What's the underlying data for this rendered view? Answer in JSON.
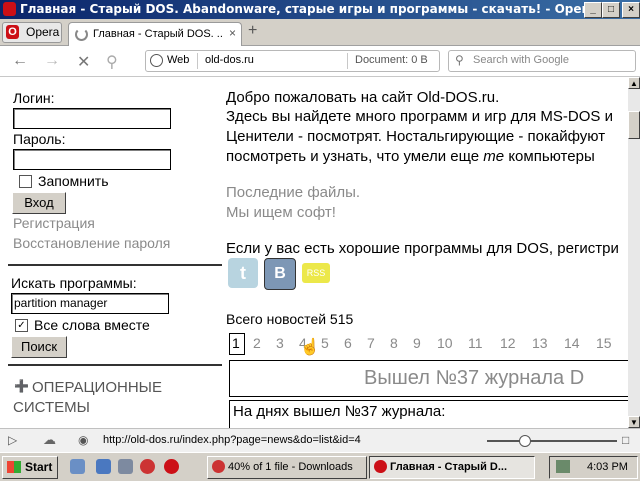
{
  "window": {
    "title": "Главная - Старый DOS. Abandonware, старые игры и программы - скачать! - Opera",
    "controls": {
      "minimize": "_",
      "maximize": "□",
      "close": "×"
    }
  },
  "browser": {
    "menu_button": "Opera",
    "tab_title": "Главная - Старый DOS. ...",
    "tab_close": "×",
    "new_tab": "+",
    "identity": "Web",
    "url": "old-dos.ru",
    "document_size": "Document:   0 B",
    "search_placeholder": "Search with Google"
  },
  "sidebar": {
    "login_label": "Логин:",
    "password_label": "Пароль:",
    "remember_label": "Запомнить",
    "login_button": "Вход",
    "register_link": "Регистрация",
    "restore_link": "Восстановление пароля",
    "search_label": "Искать программы:",
    "search_value": "partition manager",
    "all_words_label": "Все слова вместе",
    "search_button": "Поиск",
    "category_line1": "ОПЕРАЦИОННЫЕ",
    "category_line2": "СИСТЕМЫ"
  },
  "main": {
    "welcome": "Добро пожаловать на сайт Old-DOS.ru.",
    "intro_line1": "Здесь вы найдете много программ и игр для MS-DOS и",
    "intro_line2": "Ценители - посмотрят. Ностальгирующие - покайфуют",
    "intro_line3a": "посмотреть и узнать, что умели еще",
    "intro_line3b": "те",
    "intro_line3c": "компьютеры",
    "recent_files": "Последние файлы.",
    "seeking_software": "Мы ищем софт!",
    "submit_line": "Если у вас есть хорошие программы для DOS, регистри",
    "social": {
      "twitter": "t",
      "vk": "В",
      "rss": "RSS"
    },
    "news_total": "Всего новостей 515",
    "pages": [
      "1",
      "2",
      "3",
      "4",
      "5",
      "6",
      "7",
      "8",
      "9",
      "10",
      "11",
      "12",
      "13",
      "14",
      "15"
    ],
    "news_headline": "Вышел №37 журнала D",
    "news_text": "На днях вышел №37 журнала:"
  },
  "statusbar": {
    "link": "http://old-dos.ru/index.php?page=news&do=list&id=4"
  },
  "taskbar": {
    "start": "Start",
    "task_downloads": "40% of 1 file - Downloads",
    "task_opera": "Главная - Старый D...",
    "clock": "4:03 PM"
  }
}
